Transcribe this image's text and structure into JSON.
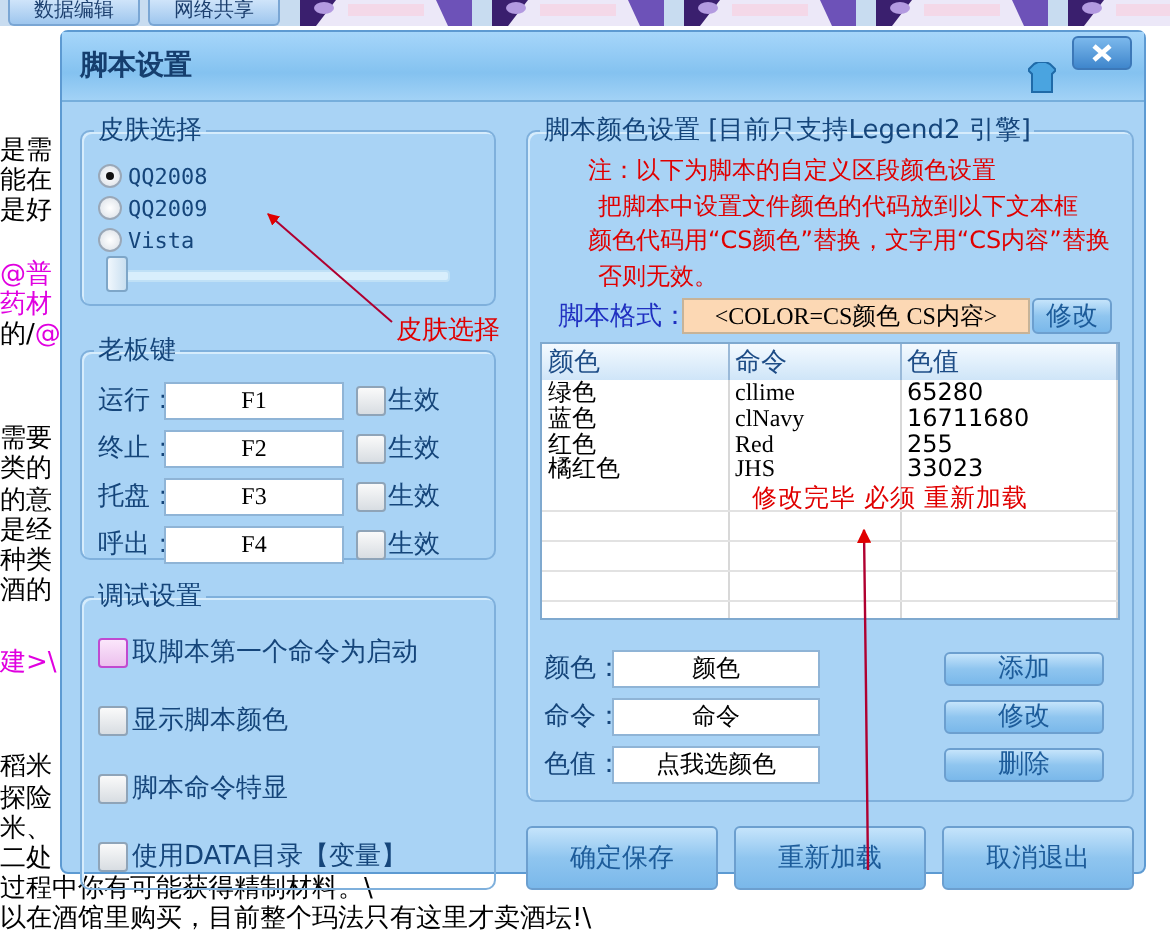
{
  "background": {
    "tabs": [
      {
        "label": "数据编辑"
      },
      {
        "label": "网络共享"
      }
    ],
    "image_tabs": [
      {
        "kind": "picture"
      },
      {
        "kind": "picture"
      },
      {
        "kind": "picture"
      },
      {
        "kind": "picture"
      },
      {
        "kind": "picture"
      }
    ],
    "paragraphs": [
      [
        [
          {
            "text": "是需",
            "color": "#000000"
          }
        ],
        [
          {
            "text": "能在",
            "color": "#000000"
          }
        ],
        [
          {
            "text": "是好",
            "color": "#000000"
          }
        ]
      ],
      [
        [
          {
            "text": "@普",
            "color": "#e000e0"
          }
        ],
        [
          {
            "text": "药材",
            "color": "#e000e0"
          }
        ],
        [
          {
            "text": "的/",
            "color": "#000000"
          },
          {
            "text": "@",
            "color": "#e000e0"
          }
        ]
      ],
      [
        [
          {
            "text": "需要",
            "color": "#000000"
          }
        ],
        [
          {
            "text": "类的",
            "color": "#000000"
          }
        ],
        [
          {
            "text": "的意",
            "color": "#000000"
          }
        ],
        [
          {
            "text": "是经",
            "color": "#000000"
          }
        ],
        [
          {
            "text": "种类",
            "color": "#000000"
          }
        ],
        [
          {
            "text": "酒的",
            "color": "#000000"
          }
        ]
      ],
      [
        [
          {
            "text": "建>\\",
            "color": "#e000e0"
          }
        ]
      ],
      [
        [
          {
            "text": "稻米",
            "color": "#000000"
          }
        ],
        [
          {
            "text": "探险",
            "color": "#000000"
          }
        ],
        [
          {
            "text": "米、",
            "color": "#000000"
          }
        ],
        [
          {
            "text": "二处",
            "color": "#000000"
          }
        ],
        [
          {
            "text": "过程中你有可能获得精制材料。\\",
            "color": "#000000"
          }
        ],
        [
          {
            "text": "以在酒馆里购买，目前整个玛法只有这里才卖酒坛!\\",
            "color": "#000000"
          }
        ]
      ]
    ]
  },
  "dialog": {
    "title": "脚本设置",
    "skin": {
      "title": "皮肤选择",
      "options": [
        {
          "label": "QQ2008",
          "selected": true
        },
        {
          "label": "QQ2009",
          "selected": false
        },
        {
          "label": "Vista",
          "selected": false
        }
      ],
      "slider": {
        "level": 0
      }
    },
    "boss_key": {
      "title": "老板键",
      "rows": [
        {
          "label": "运行：",
          "value": "F1",
          "check_label": "生效",
          "checked": false
        },
        {
          "label": "终止：",
          "value": "F2",
          "check_label": "生效",
          "checked": false
        },
        {
          "label": "托盘：",
          "value": "F3",
          "check_label": "生效",
          "checked": false
        },
        {
          "label": "呼出：",
          "value": "F4",
          "check_label": "生效",
          "checked": false
        }
      ]
    },
    "debug": {
      "title": "调试设置",
      "options": [
        {
          "label": "取脚本第一个命令为启动",
          "checked": false,
          "focused": true
        },
        {
          "label": "显示脚本颜色",
          "checked": false,
          "focused": false
        },
        {
          "label": "脚本命令特显",
          "checked": false,
          "focused": false
        },
        {
          "label": "使用DATA目录【变量】",
          "checked": false,
          "focused": false
        }
      ]
    },
    "color_settings": {
      "title": "脚本颜色设置 [目前只支持Legend2 引擎]",
      "note": [
        "注：以下为脚本的自定义区段颜色设置",
        "把脚本中设置文件颜色的代码放到以下文本框",
        "颜色代码用“CS颜色”替换，文字用“CS内容”替换",
        "否则无效。"
      ],
      "format_label": "脚本格式：",
      "format_value": "<COLOR=CS颜色  CS内容>",
      "format_button": "修改",
      "table": {
        "columns": [
          "颜色",
          "命令",
          "色值"
        ],
        "rows": [
          [
            "绿色",
            "cllime",
            "65280"
          ],
          [
            "蓝色",
            "clNavy",
            "16711680"
          ],
          [
            "红色",
            "Red",
            "255"
          ],
          [
            "橘红色",
            "JHS",
            "33023"
          ]
        ]
      },
      "fields": [
        {
          "label": "颜色：",
          "value": "颜色",
          "button": "添加"
        },
        {
          "label": "命令：",
          "value": "命令",
          "button": "修改"
        },
        {
          "label": "色值：",
          "value": "点我选颜色",
          "button": "删除"
        }
      ]
    },
    "buttons": [
      "确定保存",
      "重新加载",
      "取消退出"
    ],
    "annotations": [
      {
        "text": "皮肤选择"
      },
      {
        "text": "修改完毕 必须 重新加载"
      }
    ]
  }
}
